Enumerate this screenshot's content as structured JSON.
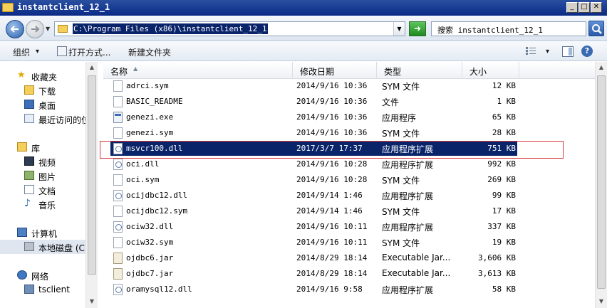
{
  "window": {
    "title": "instantclient_12_1",
    "controls": {
      "minimize": "_",
      "maximize": "□",
      "close": "✕"
    }
  },
  "address": {
    "path": "C:\\Program Files (x86)\\instantclient_12_1",
    "search_placeholder": "搜索 instantclient_12_1",
    "icons": [
      "back-arrow-icon",
      "forward-arrow-icon",
      "chevron-down-icon",
      "go-arrow-icon",
      "magnifier-icon"
    ]
  },
  "toolbar": {
    "organize": "组织",
    "organize_arrow": "▾",
    "open_with": "打开方式...",
    "new_folder": "新建文件夹",
    "view_arrow": "▾",
    "help": "?"
  },
  "nav": {
    "favorites": "收藏夹",
    "downloads": "下载",
    "desktop": "桌面",
    "recent": "最近访问的位",
    "libraries": "库",
    "videos": "视频",
    "pictures": "图片",
    "documents": "文档",
    "music": "音乐",
    "computer": "计算机",
    "local_disk": "本地磁盘 (C",
    "network": "网络",
    "tsclient": "tsclient"
  },
  "columns": {
    "name": "名称",
    "sort_arrow": "▲",
    "date": "修改日期",
    "type": "类型",
    "size": "大小"
  },
  "files": [
    {
      "name": "adrci.sym",
      "date": "2014/9/16 10:36",
      "type": "SYM 文件",
      "size": "12 KB",
      "icon": "file-icon"
    },
    {
      "name": "BASIC_README",
      "date": "2014/9/16 10:36",
      "type": "文件",
      "size": "1 KB",
      "icon": "file-icon"
    },
    {
      "name": "genezi.exe",
      "date": "2014/9/16 10:36",
      "type": "应用程序",
      "size": "65 KB",
      "icon": "exe-icon"
    },
    {
      "name": "genezi.sym",
      "date": "2014/9/16 10:36",
      "type": "SYM 文件",
      "size": "28 KB",
      "icon": "file-icon"
    },
    {
      "name": "msvcr100.dll",
      "date": "2017/3/7 17:37",
      "type": "应用程序扩展",
      "size": "751 KB",
      "icon": "dll-icon"
    },
    {
      "name": "oci.dll",
      "date": "2014/9/16 10:28",
      "type": "应用程序扩展",
      "size": "992 KB",
      "icon": "dll-icon"
    },
    {
      "name": "oci.sym",
      "date": "2014/9/16 10:28",
      "type": "SYM 文件",
      "size": "269 KB",
      "icon": "file-icon"
    },
    {
      "name": "ocijdbc12.dll",
      "date": "2014/9/14 1:46",
      "type": "应用程序扩展",
      "size": "99 KB",
      "icon": "dll-icon"
    },
    {
      "name": "ocijdbc12.sym",
      "date": "2014/9/14 1:46",
      "type": "SYM 文件",
      "size": "17 KB",
      "icon": "file-icon"
    },
    {
      "name": "ociw32.dll",
      "date": "2014/9/16 10:11",
      "type": "应用程序扩展",
      "size": "337 KB",
      "icon": "dll-icon"
    },
    {
      "name": "ociw32.sym",
      "date": "2014/9/16 10:11",
      "type": "SYM 文件",
      "size": "19 KB",
      "icon": "file-icon"
    },
    {
      "name": "ojdbc6.jar",
      "date": "2014/8/29 18:14",
      "type": "Executable Jar...",
      "size": "3,606 KB",
      "icon": "jar-icon"
    },
    {
      "name": "ojdbc7.jar",
      "date": "2014/8/29 18:14",
      "type": "Executable Jar...",
      "size": "3,613 KB",
      "icon": "jar-icon"
    },
    {
      "name": "oramysql12.dll",
      "date": "2014/9/16 9:58",
      "type": "应用程序扩展",
      "size": "58 KB",
      "icon": "dll-icon"
    }
  ],
  "selected_file": "msvcr100.dll",
  "colors": {
    "title_bar": "#0a2a86",
    "selection": "#0a246a",
    "highlight_box": "#d9363e"
  }
}
